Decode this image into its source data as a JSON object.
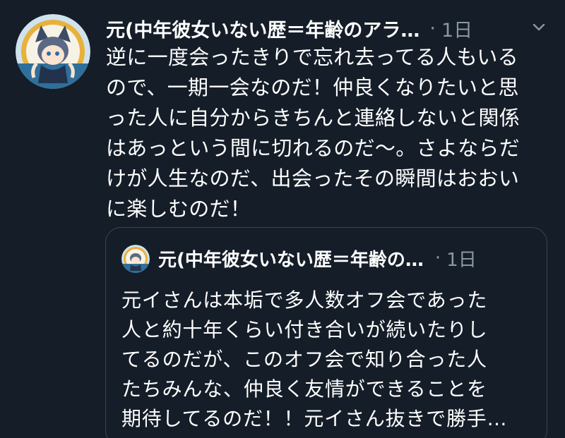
{
  "tweet": {
    "author_name": "元(中年彼女いない歴＝年齢のアラ…",
    "separator": "·",
    "timestamp": "1日",
    "more_icon": "chevron-down-icon",
    "text_lines": [
      "逆に一度会ったきりで忘れ去ってる人もいる",
      "ので、一期一会なのだ！仲良くなりたいと思",
      "った人に自分からきちんと連絡しないと関係",
      "はあっという間に切れるのだ〜。さよならだ",
      "けが人生なのだ、出会ったその瞬間はおおい",
      "に楽しむのだ！"
    ]
  },
  "quoted_tweet": {
    "author_name": "元(中年彼女いない歴＝年齢の…",
    "separator": "·",
    "timestamp": "1日",
    "text_lines": [
      "元イさんは本垢で多人数オフ会であった",
      "人と約十年くらい付き合いが続いたりし",
      "てるのだが、このオフ会で知り合った人",
      "たちみんな、仲良く友情ができることを",
      "期待してるのだ！！元イさん抜きで勝手…"
    ]
  },
  "colors": {
    "background": "#151d28",
    "text_primary": "#ffffff",
    "text_secondary": "#8899a6",
    "quote_border": "#3a4653"
  }
}
